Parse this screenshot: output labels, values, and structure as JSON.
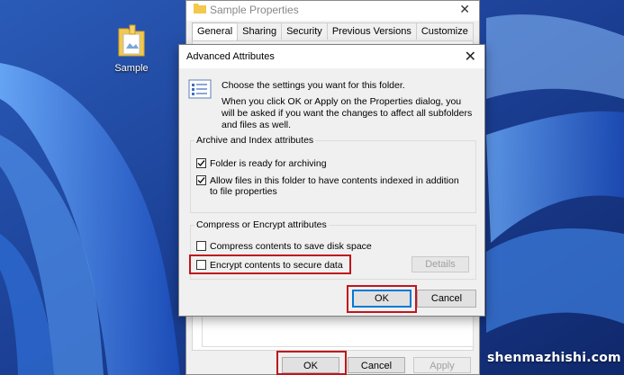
{
  "desktop": {
    "icon_label": "Sample"
  },
  "properties": {
    "title": "Sample Properties",
    "tabs": [
      {
        "label": "General",
        "active": true
      },
      {
        "label": "Sharing",
        "active": false
      },
      {
        "label": "Security",
        "active": false
      },
      {
        "label": "Previous Versions",
        "active": false
      },
      {
        "label": "Customize",
        "active": false
      }
    ],
    "ok_label": "OK",
    "cancel_label": "Cancel",
    "apply_label": "Apply"
  },
  "advanced": {
    "title": "Advanced Attributes",
    "intro_line1": "Choose the settings you want for this folder.",
    "intro_line2": "When you click OK or Apply on the Properties dialog, you will be asked if you want the changes to affect all subfolders and files as well.",
    "archive_group": {
      "title": "Archive and Index attributes",
      "archive_label": "Folder is ready for archiving",
      "archive_checked": true,
      "index_label": "Allow files in this folder to have contents indexed in addition to file properties",
      "index_checked": true
    },
    "compress_group": {
      "title": "Compress or Encrypt attributes",
      "compress_label": "Compress contents to save disk space",
      "compress_checked": false,
      "encrypt_label": "Encrypt contents to secure data",
      "encrypt_checked": false,
      "details_label": "Details"
    },
    "ok_label": "OK",
    "cancel_label": "Cancel"
  },
  "watermark": "shenmazhishi.com",
  "colors": {
    "highlight": "#c0151b",
    "accent": "#0078d7"
  }
}
